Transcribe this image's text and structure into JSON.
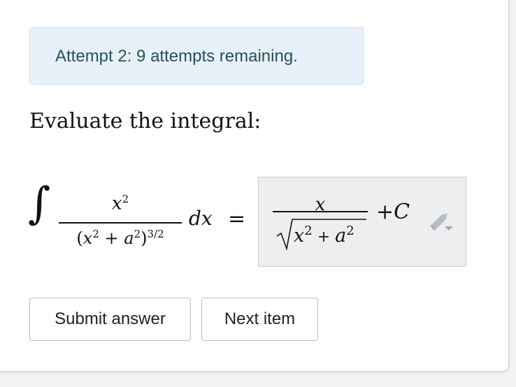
{
  "alert": {
    "text": "Attempt 2: 9 attempts remaining.",
    "color": "#e8f1f9"
  },
  "question": {
    "prompt": "Evaluate the integral:"
  },
  "integral": {
    "sign": "∫",
    "numerator": "x",
    "numerator_exp": "2",
    "denominator_open": "(",
    "denominator_x": "x",
    "denominator_x_exp": "2",
    "denominator_plus": " + ",
    "denominator_a": "a",
    "denominator_a_exp": "2",
    "denominator_close": ")",
    "denominator_outer_exp": "3/2",
    "differential": "dx",
    "equals": "="
  },
  "answer": {
    "numerator": "x",
    "radicand_x": "x",
    "radicand_x_exp": "2",
    "radicand_plus": "+",
    "radicand_a": "a",
    "radicand_a_exp": "2",
    "plus": "+",
    "constant": "C",
    "edit_icon": "pencil-dropdown-icon"
  },
  "actions": {
    "submit_label": "Submit answer",
    "next_label": "Next item"
  }
}
